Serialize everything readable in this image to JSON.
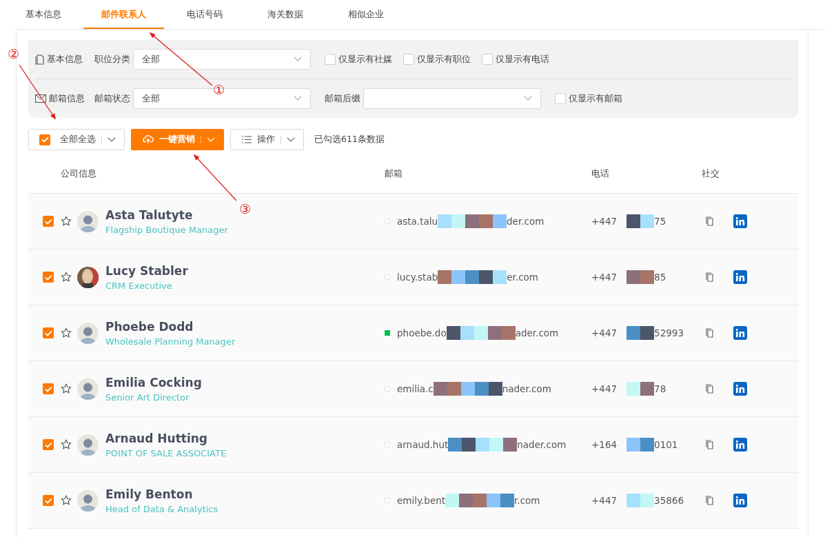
{
  "tabs": [
    {
      "label": "基本信息",
      "selected": false
    },
    {
      "label": "邮件联系人",
      "selected": true
    },
    {
      "label": "电话号码",
      "selected": false
    },
    {
      "label": "海关数据",
      "selected": false
    },
    {
      "label": "相似企业",
      "selected": false
    }
  ],
  "filters": {
    "rows": [
      {
        "kind": "basic",
        "section": "基本信息",
        "select_label": "职位分类",
        "select_value": "全部",
        "checkboxes": [
          {
            "label": "仅显示有社媒",
            "checked": false
          },
          {
            "label": "仅显示有职位",
            "checked": false
          },
          {
            "label": "仅显示有电话",
            "checked": false
          }
        ]
      },
      {
        "kind": "mail",
        "section": "邮箱信息",
        "select_label": "邮箱状态",
        "select_value": "全部",
        "extra_label": "邮箱后缀",
        "checkboxes": [
          {
            "label": "仅显示有邮箱",
            "checked": false
          }
        ]
      }
    ]
  },
  "toolbar": {
    "select_all": {
      "label": "全部全选",
      "checked": true
    },
    "marketing_button": "一键营销",
    "actions_button": "操作",
    "selection_count": "已勾选611条数据"
  },
  "table": {
    "columns": [
      "公司信息",
      "邮箱",
      "电话",
      "社交"
    ],
    "rows": [
      {
        "checked": true,
        "starred": false,
        "avatar": {
          "kind": "default"
        },
        "name": "Asta Talutyte",
        "title": "Flagship Boutique Manager",
        "email_status": {
          "color": "#ffffff"
        },
        "email_start": "asta.talu",
        "email_end": "der.com",
        "phone_start": "+447",
        "phone_end": "75"
      },
      {
        "checked": true,
        "starred": false,
        "name": "Lucy Stabler",
        "title": "CRM Executive",
        "email_status": {
          "color": "#ffffff"
        },
        "email_start": "lucy.stab",
        "email_end": "er.com",
        "phone_start": "+447",
        "phone_end": "85"
      },
      {
        "checked": true,
        "starred": false,
        "avatar": {
          "kind": "default"
        },
        "name": "Phoebe Dodd",
        "title": "Wholesale Planning Manager",
        "email_status": {
          "color": "#00c250"
        },
        "email_start": "phoebe.do",
        "email_end": "ader.com",
        "phone_start": "+447",
        "phone_end": "52993"
      },
      {
        "checked": true,
        "starred": false,
        "avatar": {
          "kind": "default"
        },
        "name": "Emilia Cocking",
        "title": "Senior Art Director",
        "email_status": {
          "color": "#ffffff"
        },
        "email_start": "emilia.c",
        "email_end": "nader.com",
        "phone_start": "+447",
        "phone_end": "78"
      },
      {
        "checked": true,
        "starred": false,
        "avatar": {
          "kind": "default"
        },
        "name": "Arnaud Hutting",
        "title": "POINT OF SALE ASSOCIATE",
        "email_status": {
          "color": "#ffffff"
        },
        "email_start": "arnaud.hut",
        "email_end": "nader.com",
        "phone_start": "+164",
        "phone_end": "0101"
      },
      {
        "checked": true,
        "starred": false,
        "avatar": {
          "kind": "default"
        },
        "name": "Emily Benton",
        "title": "Head of Data & Analytics",
        "email_status": {
          "color": "#ffffff"
        },
        "email_start": "emily.bent",
        "email_end": "r.com",
        "phone_start": "+447",
        "phone_end": "35866"
      }
    ]
  },
  "annotations": [
    {
      "label": "①"
    },
    {
      "label": "②"
    },
    {
      "label": "③"
    }
  ]
}
